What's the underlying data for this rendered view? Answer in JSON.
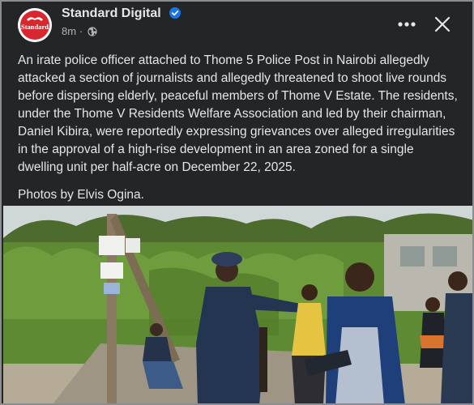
{
  "post": {
    "page_name": "Standard Digital",
    "avatar_text": "Standard",
    "timestamp": "8m",
    "meta_separator": "·",
    "caption": "An irate police officer attached to Thome 5 Police Post in Nairobi allegedly attacked a section of journalists and allegedly threatened to shoot live rounds before dispersing elderly, peaceful members of Thome V Estate. The residents, under the Thome V Residents Welfare Association and led by their chairman, Daniel Kibira, were reportedly expressing grievances over alleged irregularities in the approval of a high-rise development in an area zoned for a single dwelling unit per half-acre on December 22, 2025.",
    "credit": "Photos by Elvis Ogina."
  },
  "icons": {
    "verified": "verified-badge-icon",
    "audience": "globe-icon",
    "more": "more-options-icon",
    "close": "close-icon"
  },
  "colors": {
    "background": "#242526",
    "text": "#e4e6eb",
    "secondary_text": "#b0b3b8",
    "verified_blue": "#1b74e4",
    "brand_red": "#d6282e"
  }
}
